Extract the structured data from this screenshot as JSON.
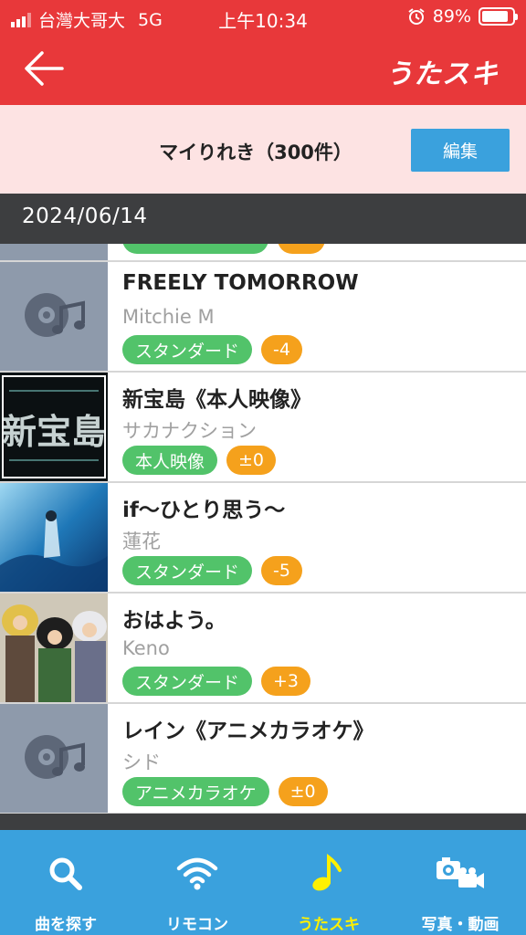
{
  "status_bar": {
    "carrier": "台灣大哥大",
    "network": "5G",
    "time": "上午10:34",
    "battery": "89%",
    "battery_level": 0.89
  },
  "nav": {
    "brand": "うたスキ"
  },
  "header": {
    "title": "マイりれき（300件）",
    "edit_label": "編集"
  },
  "date_header": "2024/06/14",
  "history": [
    {
      "title": "FREELY TOMORROW",
      "artist": "Mitchie M",
      "category": "スタンダード",
      "key": "-4",
      "thumb": "placeholder"
    },
    {
      "title": "新宝島《本人映像》",
      "artist": "サカナクション",
      "category": "本人映像",
      "key": "±0",
      "thumb": "art-shintakarajima"
    },
    {
      "title": "if〜ひとり思う〜",
      "artist": "蓮花",
      "category": "スタンダード",
      "key": "-5",
      "thumb": "art-blue"
    },
    {
      "title": "おはよう。",
      "artist": "Keno",
      "category": "スタンダード",
      "key": "+3",
      "thumb": "art-anime"
    },
    {
      "title": "レイン《アニメカラオケ》",
      "artist": "シド",
      "category": "アニメカラオケ",
      "key": "±0",
      "thumb": "placeholder"
    }
  ],
  "tabs": [
    {
      "label": "曲を探す",
      "icon": "search-icon",
      "active": false
    },
    {
      "label": "リモコン",
      "icon": "wifi-icon",
      "active": false
    },
    {
      "label": "うたスキ",
      "icon": "music-note-icon",
      "active": true
    },
    {
      "label": "写真・動画",
      "icon": "camera-video-icon",
      "active": false
    }
  ],
  "colors": {
    "header_red": "#e8383a",
    "header_band": "#fde3e3",
    "tab_blue": "#3aa1dd",
    "active_yellow": "#fff000",
    "tag_green": "#52c36a",
    "tag_orange": "#f5a11c"
  }
}
